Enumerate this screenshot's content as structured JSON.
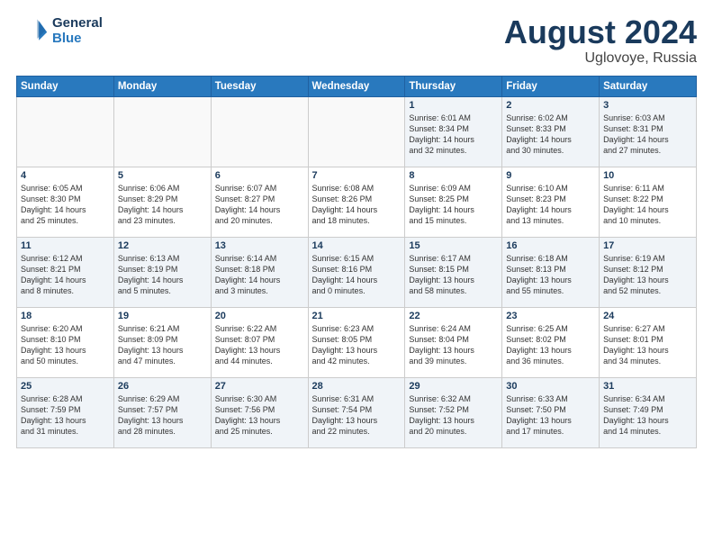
{
  "header": {
    "logo_line1": "General",
    "logo_line2": "Blue",
    "month": "August 2024",
    "location": "Uglovoye, Russia"
  },
  "weekdays": [
    "Sunday",
    "Monday",
    "Tuesday",
    "Wednesday",
    "Thursday",
    "Friday",
    "Saturday"
  ],
  "weeks": [
    [
      {
        "num": "",
        "info": ""
      },
      {
        "num": "",
        "info": ""
      },
      {
        "num": "",
        "info": ""
      },
      {
        "num": "",
        "info": ""
      },
      {
        "num": "1",
        "info": "Sunrise: 6:01 AM\nSunset: 8:34 PM\nDaylight: 14 hours\nand 32 minutes."
      },
      {
        "num": "2",
        "info": "Sunrise: 6:02 AM\nSunset: 8:33 PM\nDaylight: 14 hours\nand 30 minutes."
      },
      {
        "num": "3",
        "info": "Sunrise: 6:03 AM\nSunset: 8:31 PM\nDaylight: 14 hours\nand 27 minutes."
      }
    ],
    [
      {
        "num": "4",
        "info": "Sunrise: 6:05 AM\nSunset: 8:30 PM\nDaylight: 14 hours\nand 25 minutes."
      },
      {
        "num": "5",
        "info": "Sunrise: 6:06 AM\nSunset: 8:29 PM\nDaylight: 14 hours\nand 23 minutes."
      },
      {
        "num": "6",
        "info": "Sunrise: 6:07 AM\nSunset: 8:27 PM\nDaylight: 14 hours\nand 20 minutes."
      },
      {
        "num": "7",
        "info": "Sunrise: 6:08 AM\nSunset: 8:26 PM\nDaylight: 14 hours\nand 18 minutes."
      },
      {
        "num": "8",
        "info": "Sunrise: 6:09 AM\nSunset: 8:25 PM\nDaylight: 14 hours\nand 15 minutes."
      },
      {
        "num": "9",
        "info": "Sunrise: 6:10 AM\nSunset: 8:23 PM\nDaylight: 14 hours\nand 13 minutes."
      },
      {
        "num": "10",
        "info": "Sunrise: 6:11 AM\nSunset: 8:22 PM\nDaylight: 14 hours\nand 10 minutes."
      }
    ],
    [
      {
        "num": "11",
        "info": "Sunrise: 6:12 AM\nSunset: 8:21 PM\nDaylight: 14 hours\nand 8 minutes."
      },
      {
        "num": "12",
        "info": "Sunrise: 6:13 AM\nSunset: 8:19 PM\nDaylight: 14 hours\nand 5 minutes."
      },
      {
        "num": "13",
        "info": "Sunrise: 6:14 AM\nSunset: 8:18 PM\nDaylight: 14 hours\nand 3 minutes."
      },
      {
        "num": "14",
        "info": "Sunrise: 6:15 AM\nSunset: 8:16 PM\nDaylight: 14 hours\nand 0 minutes."
      },
      {
        "num": "15",
        "info": "Sunrise: 6:17 AM\nSunset: 8:15 PM\nDaylight: 13 hours\nand 58 minutes."
      },
      {
        "num": "16",
        "info": "Sunrise: 6:18 AM\nSunset: 8:13 PM\nDaylight: 13 hours\nand 55 minutes."
      },
      {
        "num": "17",
        "info": "Sunrise: 6:19 AM\nSunset: 8:12 PM\nDaylight: 13 hours\nand 52 minutes."
      }
    ],
    [
      {
        "num": "18",
        "info": "Sunrise: 6:20 AM\nSunset: 8:10 PM\nDaylight: 13 hours\nand 50 minutes."
      },
      {
        "num": "19",
        "info": "Sunrise: 6:21 AM\nSunset: 8:09 PM\nDaylight: 13 hours\nand 47 minutes."
      },
      {
        "num": "20",
        "info": "Sunrise: 6:22 AM\nSunset: 8:07 PM\nDaylight: 13 hours\nand 44 minutes."
      },
      {
        "num": "21",
        "info": "Sunrise: 6:23 AM\nSunset: 8:05 PM\nDaylight: 13 hours\nand 42 minutes."
      },
      {
        "num": "22",
        "info": "Sunrise: 6:24 AM\nSunset: 8:04 PM\nDaylight: 13 hours\nand 39 minutes."
      },
      {
        "num": "23",
        "info": "Sunrise: 6:25 AM\nSunset: 8:02 PM\nDaylight: 13 hours\nand 36 minutes."
      },
      {
        "num": "24",
        "info": "Sunrise: 6:27 AM\nSunset: 8:01 PM\nDaylight: 13 hours\nand 34 minutes."
      }
    ],
    [
      {
        "num": "25",
        "info": "Sunrise: 6:28 AM\nSunset: 7:59 PM\nDaylight: 13 hours\nand 31 minutes."
      },
      {
        "num": "26",
        "info": "Sunrise: 6:29 AM\nSunset: 7:57 PM\nDaylight: 13 hours\nand 28 minutes."
      },
      {
        "num": "27",
        "info": "Sunrise: 6:30 AM\nSunset: 7:56 PM\nDaylight: 13 hours\nand 25 minutes."
      },
      {
        "num": "28",
        "info": "Sunrise: 6:31 AM\nSunset: 7:54 PM\nDaylight: 13 hours\nand 22 minutes."
      },
      {
        "num": "29",
        "info": "Sunrise: 6:32 AM\nSunset: 7:52 PM\nDaylight: 13 hours\nand 20 minutes."
      },
      {
        "num": "30",
        "info": "Sunrise: 6:33 AM\nSunset: 7:50 PM\nDaylight: 13 hours\nand 17 minutes."
      },
      {
        "num": "31",
        "info": "Sunrise: 6:34 AM\nSunset: 7:49 PM\nDaylight: 13 hours\nand 14 minutes."
      }
    ]
  ]
}
